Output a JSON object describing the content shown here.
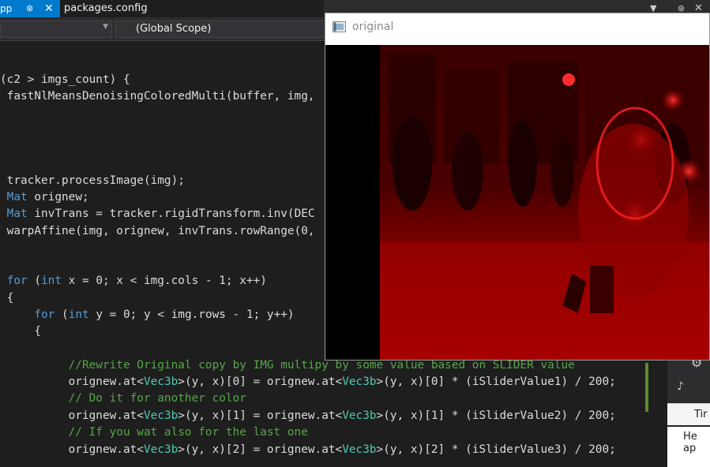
{
  "tabs": {
    "previous_tab_label": "pp",
    "active_tab_label": "packages.config"
  },
  "navigation": {
    "scope_label": "(Global Scope)"
  },
  "editor": {
    "lines": {
      "l1_pre": "(c2 > imgs_count) {",
      "l2_pre": " fastNlMeansDenoisingColoredMulti(buffer, img, ",
      "l3_pre": " tracker.processImage(img);",
      "l4_kw": "Mat",
      "l4_rest": " orignew;",
      "l5_kw": "Mat",
      "l5_rest": " invTrans = tracker.rigidTransform.inv(DEC",
      "l6_pre": " warpAffine(img, orignew, invTrans.rowRange(0, ",
      "l7_kw": "for",
      "l7_a": " (",
      "l7_kw2": "int",
      "l7_rest": " x = 0; x < img.cols - 1; x++)",
      "l8_pre": " {",
      "l9_kw": "for",
      "l9_a": " (",
      "l9_kw2": "int",
      "l9_rest": " y = 0; y < img.rows - 1; y++)",
      "l10_pre": "     {",
      "c1": "//Rewrite Original copy by IMG multipy by some value based on SLIDER value",
      "a1_pre": "orignew.at<",
      "a1_ty": "Vec3b",
      "a1_mid": ">(y, x)[0] = orignew.at<",
      "a1_ty2": "Vec3b",
      "a1_end": ">(y, x)[0] * (iSliderValue1) / 200; ",
      "c2": "// Do it for another color",
      "a2_pre": "orignew.at<",
      "a2_ty": "Vec3b",
      "a2_mid": ">(y, x)[1] = orignew.at<",
      "a2_ty2": "Vec3b",
      "a2_end": ">(y, x)[1] * (iSliderValue2) / 200; ",
      "c3": "// If you wat also for the last one",
      "a3_pre": "orignew.at<",
      "a3_ty": "Vec3b",
      "a3_mid": ">(y, x)[2] = orignew.at<",
      "a3_ty2": "Vec3b",
      "a3_end": ">(y, x)[2] * (iSliderValue3) / 200; "
    }
  },
  "side_panel": {
    "tab_label": "Tir",
    "body_line1": "He",
    "body_line2": "ap"
  },
  "image_window": {
    "title": "original"
  },
  "icons": {
    "pin": "pin-icon",
    "close": "close-icon",
    "dropdown": "chevron-down-icon",
    "gear": "gear-icon"
  },
  "colors": {
    "accent": "#007acc",
    "keyword": "#569cd6",
    "type": "#4ec9b0",
    "comment": "#57a64a"
  }
}
